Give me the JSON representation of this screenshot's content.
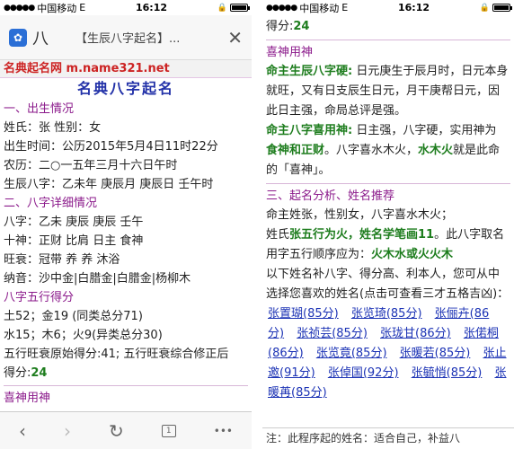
{
  "status": {
    "carrier": "中国移动",
    "network": "E",
    "time": "16:12"
  },
  "browser": {
    "tab_partial": "八",
    "tab_title": "【生辰八字起名】...",
    "close": "✕"
  },
  "site": {
    "bar": "名典起名网 m.name321.net",
    "title": "名典八字起名"
  },
  "left": {
    "s1_title": "一、出生情况",
    "s1_r1": "姓氏：张     性别：女",
    "s1_r2": "出生时间：公历2015年5月4日11时22分",
    "s1_r3": "农历：二○一五年三月十六日午时",
    "s1_r4": "生辰八字：乙未年 庚辰月 庚辰日 壬午时",
    "s2_title": "二、八字详细情况",
    "s2_r1": "八字：乙未    庚辰    庚辰    壬午",
    "s2_r2": "十神：正财    比肩    日主    食神",
    "s2_r3": "旺衰：冠带    养    养    沐浴",
    "s2_r4": "纳音：沙中金|白腊金|白腊金|杨柳木",
    "s3_title": "八字五行得分",
    "s3_r1": "土52；金19 (同类总分71)",
    "s3_r2": "水15；木6；火9(异类总分30)",
    "s3_r3": "五行旺衰原始得分:41; 五行旺衰综合修正后",
    "s3_r4_a": "得分:",
    "s3_r4_b": "24",
    "s4_title": "喜神用神"
  },
  "right": {
    "top_a": "得分:",
    "top_b": "24",
    "h1": "喜神用神",
    "p1_a": "命主生辰八字硬:",
    "p1_b": " 日元庚生于辰月时，日元本身就旺，又有日支辰生日元，月干庚帮日元，因此日主强，命局总评是强。",
    "p2_a": "命主八字喜用神:",
    "p2_b": " 日主强，八字硬，实用神为 ",
    "p2_c": "食神和正财",
    "p2_d": "。八字喜水木火，",
    "p2_e": "水木火",
    "p2_f": "就是此命的「喜神」。",
    "h2": "三、起名分析、姓名推荐",
    "p3": "命主姓张，性别女，八字喜水木火；",
    "p4_a": "姓氏",
    "p4_b": "张五行为火，姓名学笔画11",
    "p4_c": "。此八字取名用字五行顺序应为：",
    "p4_d": "火木水或火火木",
    "p5": "以下姓名补八字、得分高、利本人，您可从中选择您喜欢的姓名(点击可查看三才五格吉凶)：",
    "names": [
      "张置瑚(85分)",
      "张览琦(85分)",
      "张俪卉(86分)",
      "张祯芸(85分)",
      "张珑甘(86分)",
      "张偌桐(86分)",
      "张览竟(85分)",
      "张暖若(85分)",
      "张止邀(91分)",
      "张倬国(92分)",
      "张毓悄(85分)",
      "张暖苒(85分)"
    ],
    "note": "注：此程序起的姓名：适合自己，补益八"
  },
  "toolbar": {
    "back": "‹",
    "forward": "›",
    "reload": "↻",
    "tabs": "1",
    "more": "•••"
  }
}
